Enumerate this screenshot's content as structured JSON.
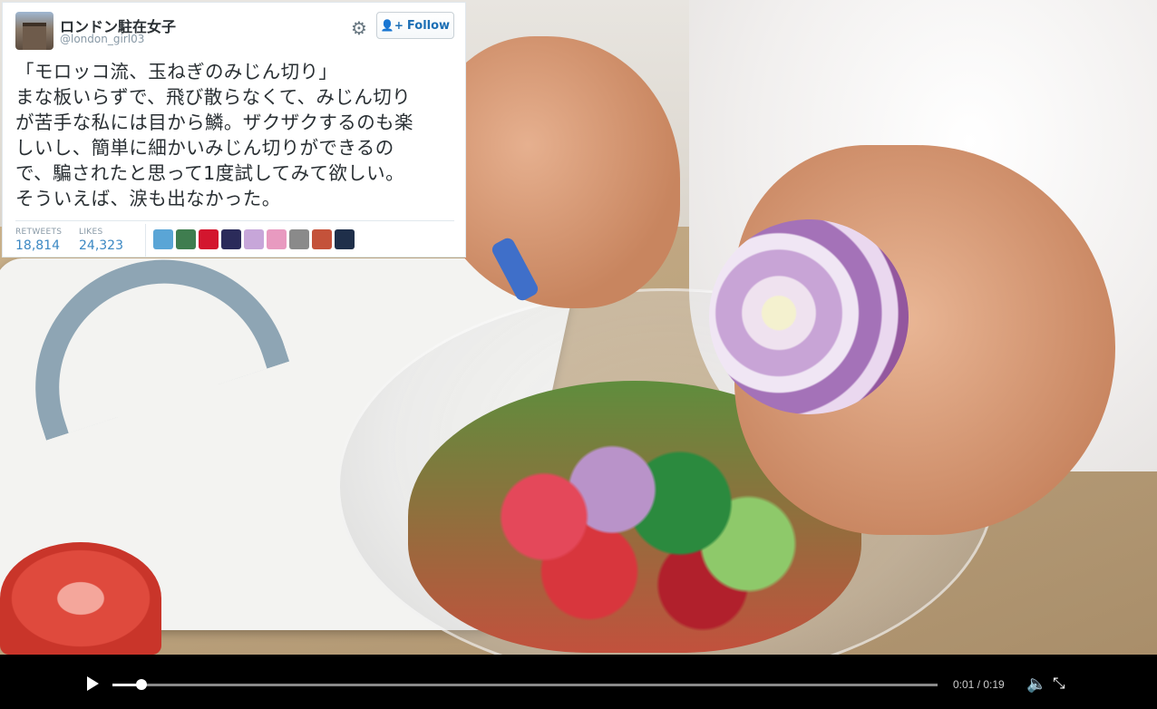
{
  "tweet": {
    "display_name": "ロンドン駐在女子",
    "handle": "@london_girl03",
    "follow_label": "Follow",
    "text": "「モロッコ流、玉ねぎのみじん切り」\nまな板いらずで、飛び散らなくて、みじん切り\nが苦手な私には目から鱗。ザクザクするのも楽\nしいし、簡単に細かいみじん切りができるの\nで、騙されたと思って1度試してみて欲しい。\nそういえば、涙も出なかった。",
    "retweets_label": "RETWEETS",
    "retweets": "18,814",
    "likes_label": "LIKES",
    "likes": "24,323",
    "liker_colors": [
      "#5aa5d6",
      "#3f7d4f",
      "#d3162e",
      "#2b2b5a",
      "#c7a6d9",
      "#e89ac0",
      "#8a8a8a",
      "#c4523a",
      "#1f2f4a"
    ]
  },
  "player": {
    "time_display": "0:01 / 0:19",
    "progress": 0.035,
    "icons": {
      "play": "play-icon",
      "volume": "volume-icon",
      "exit_fullscreen": "exit-fullscreen-icon",
      "settings": "gear-icon"
    }
  }
}
